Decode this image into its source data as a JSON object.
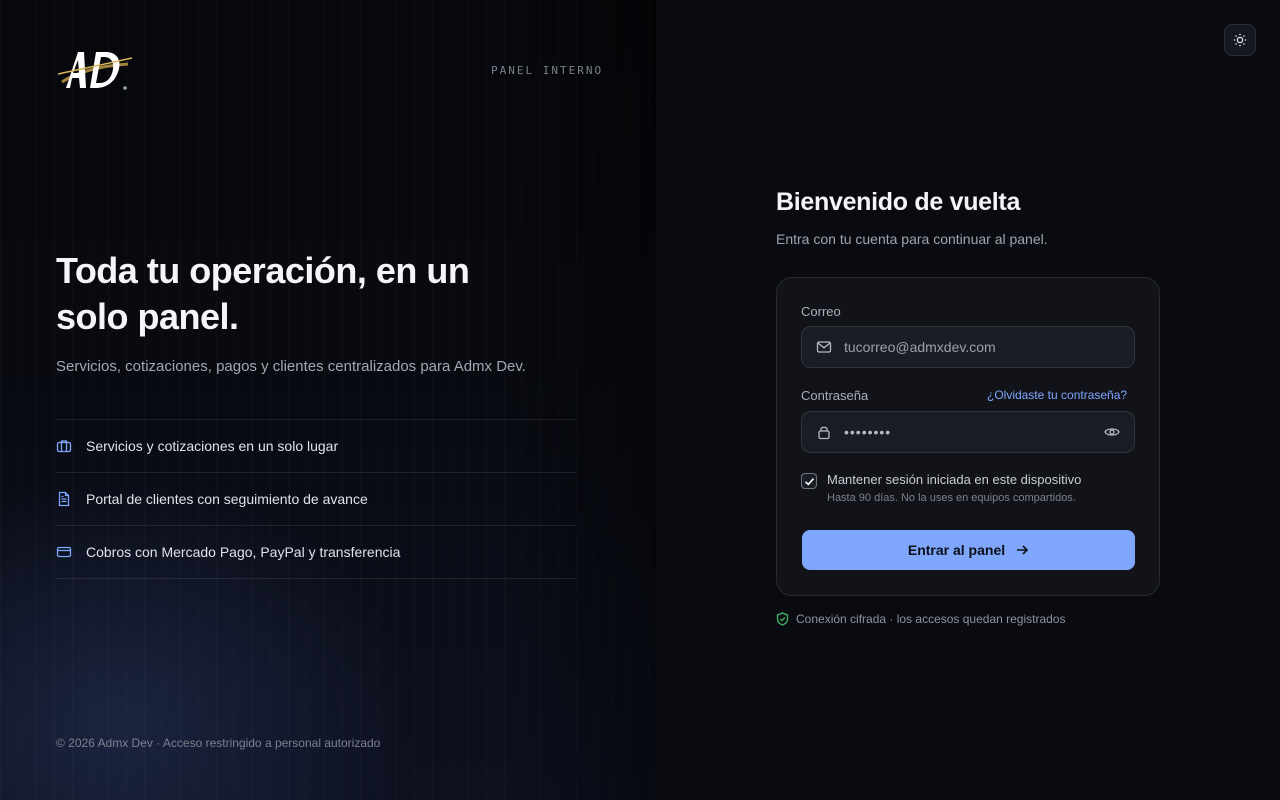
{
  "brand": {
    "logo_text": "AD",
    "panel_tag": "PANEL INTERNO"
  },
  "hero": {
    "headline": "Toda tu operación, en un solo panel.",
    "subline": "Servicios, cotizaciones, pagos y clientes centralizados para Admx Dev.",
    "features": [
      {
        "icon": "briefcase-icon",
        "label": "Servicios y cotizaciones en un solo lugar"
      },
      {
        "icon": "document-icon",
        "label": "Portal de clientes con seguimiento de avance"
      },
      {
        "icon": "credit-card-icon",
        "label": "Cobros con Mercado Pago, PayPal y transferencia"
      }
    ],
    "footer": "© 2026 Admx Dev · Acceso restringido a personal autorizado"
  },
  "login": {
    "title": "Bienvenido de vuelta",
    "subtitle": "Entra con tu cuenta para continuar al panel.",
    "email_label": "Correo",
    "email_placeholder": "tucorreo@admxdev.com",
    "password_label": "Contraseña",
    "forgot_link": "¿Olvidaste tu contraseña?",
    "password_value": "••••••••",
    "remember_label": "Mantener sesión iniciada en este dispositivo",
    "remember_hint": "Hasta 90 días. No la uses en equipos compartidos.",
    "remember_checked": true,
    "submit_label": "Entrar al panel",
    "security_note": "Conexión cifrada · los accesos quedan registrados"
  },
  "colors": {
    "accent": "#7ea6fb",
    "link": "#7ea6ff",
    "secure_green": "#3fb96a",
    "icon_blue": "#7ea6ff"
  }
}
